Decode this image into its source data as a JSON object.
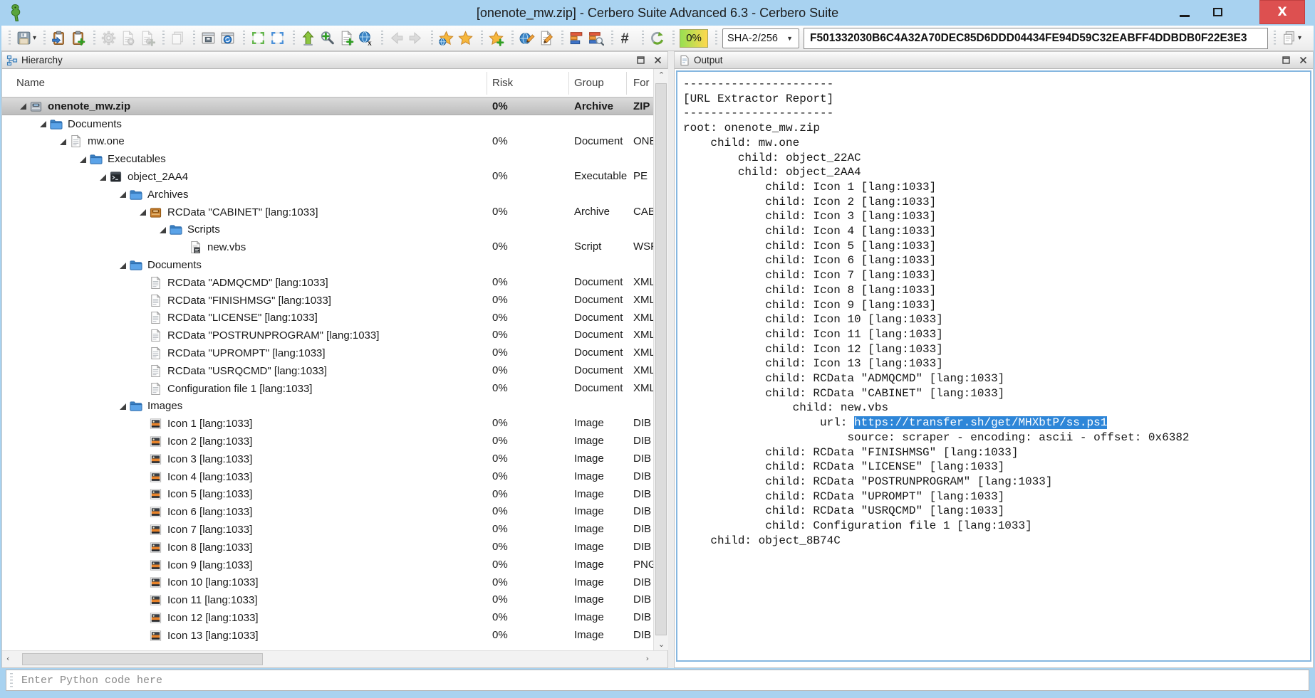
{
  "window": {
    "title": "[onenote_mw.zip] - Cerbero Suite Advanced 6.3 - Cerbero Suite"
  },
  "toolbar": {
    "progress_badge": "0%",
    "hash_algorithm": "SHA-2/256",
    "hash_value": "F501332030B6C4A32A70DEC85D6DDD04434FE94D59C32EABFF4DDBDB0F22E3E3",
    "button_groups": [
      [
        {
          "name": "save",
          "icon": "floppy",
          "caret": true
        }
      ],
      [
        {
          "name": "paste-analyze",
          "icon": "clipboard-arrow"
        },
        {
          "name": "paste-add",
          "icon": "clipboard-plus"
        }
      ],
      [
        {
          "name": "settings",
          "icon": "gear",
          "disabled": true
        },
        {
          "name": "file-settings",
          "icon": "page-gear",
          "disabled": true
        },
        {
          "name": "file-add-settings",
          "icon": "page-plus-gear",
          "disabled": true
        }
      ],
      [
        {
          "name": "copy",
          "icon": "copy-pages",
          "disabled": true
        }
      ],
      [
        {
          "name": "save-layout",
          "icon": "window-save"
        },
        {
          "name": "sync-view",
          "icon": "window-sync"
        }
      ],
      [
        {
          "name": "select-region-green",
          "icon": "select-corners-green"
        },
        {
          "name": "select-region-blue",
          "icon": "select-corners-blue"
        }
      ],
      [
        {
          "name": "insert-tool",
          "icon": "plug-up"
        },
        {
          "name": "zoom-add",
          "icon": "magnifier-plus"
        },
        {
          "name": "page-add",
          "icon": "page-plus"
        },
        {
          "name": "hex-globe",
          "icon": "globe-x"
        }
      ],
      [
        {
          "name": "back",
          "icon": "arrow-left",
          "disabled": true
        },
        {
          "name": "forward",
          "icon": "arrow-right",
          "disabled": true
        }
      ],
      [
        {
          "name": "bookmark-global",
          "icon": "star-globe"
        },
        {
          "name": "bookmark",
          "icon": "star"
        }
      ],
      [
        {
          "name": "bookmark-add",
          "icon": "star-plus"
        }
      ],
      [
        {
          "name": "edit-global",
          "icon": "globe-pencil"
        },
        {
          "name": "notes",
          "icon": "page-pencil"
        }
      ],
      [
        {
          "name": "statistics",
          "icon": "bars"
        },
        {
          "name": "statistics-inspect",
          "icon": "bars-magnifier"
        }
      ],
      [
        {
          "name": "hash-symbol",
          "icon": "hash"
        }
      ],
      [
        {
          "name": "recompute-hash",
          "icon": "refresh"
        }
      ]
    ],
    "copy_hash_button": {
      "name": "copy-hash",
      "icon": "copy-export",
      "caret": true
    }
  },
  "hierarchy": {
    "title": "Hierarchy",
    "columns": [
      "Name",
      "Risk",
      "Group",
      "For"
    ],
    "rows": [
      {
        "name": "onenote_mw.zip",
        "icon": "zip-archive",
        "level": 0,
        "expander": true,
        "risk": "0%",
        "group": "Archive",
        "format": "ZIP",
        "selected": true
      },
      {
        "name": "Documents",
        "icon": "folder",
        "level": 1,
        "expander": true,
        "risk": "",
        "group": "",
        "format": ""
      },
      {
        "name": "mw.one",
        "icon": "document",
        "level": 2,
        "expander": true,
        "risk": "0%",
        "group": "Document",
        "format": "ONE"
      },
      {
        "name": "Executables",
        "icon": "folder",
        "level": 3,
        "expander": true,
        "risk": "",
        "group": "",
        "format": ""
      },
      {
        "name": "object_2AA4",
        "icon": "executable",
        "level": 4,
        "expander": true,
        "risk": "0%",
        "group": "Executable",
        "format": "PE"
      },
      {
        "name": "Archives",
        "icon": "folder",
        "level": 5,
        "expander": true,
        "risk": "",
        "group": "",
        "format": ""
      },
      {
        "name": "RCData \"CABINET\" [lang:1033]",
        "icon": "cab-archive",
        "level": 6,
        "expander": true,
        "risk": "0%",
        "group": "Archive",
        "format": "CAB"
      },
      {
        "name": "Scripts",
        "icon": "folder",
        "level": 7,
        "expander": true,
        "risk": "",
        "group": "",
        "format": ""
      },
      {
        "name": "new.vbs",
        "icon": "script",
        "level": 8,
        "expander": false,
        "risk": "0%",
        "group": "Script",
        "format": "WSF"
      },
      {
        "name": "Documents",
        "icon": "folder",
        "level": 5,
        "expander": true,
        "risk": "",
        "group": "",
        "format": ""
      },
      {
        "name": "RCData \"ADMQCMD\" [lang:1033]",
        "icon": "document",
        "level": 6,
        "expander": false,
        "risk": "0%",
        "group": "Document",
        "format": "XML"
      },
      {
        "name": "RCData \"FINISHMSG\" [lang:1033]",
        "icon": "document",
        "level": 6,
        "expander": false,
        "risk": "0%",
        "group": "Document",
        "format": "XML"
      },
      {
        "name": "RCData \"LICENSE\" [lang:1033]",
        "icon": "document",
        "level": 6,
        "expander": false,
        "risk": "0%",
        "group": "Document",
        "format": "XML"
      },
      {
        "name": "RCData \"POSTRUNPROGRAM\" [lang:1033]",
        "icon": "document",
        "level": 6,
        "expander": false,
        "risk": "0%",
        "group": "Document",
        "format": "XML"
      },
      {
        "name": "RCData \"UPROMPT\" [lang:1033]",
        "icon": "document",
        "level": 6,
        "expander": false,
        "risk": "0%",
        "group": "Document",
        "format": "XML"
      },
      {
        "name": "RCData \"USRQCMD\" [lang:1033]",
        "icon": "document",
        "level": 6,
        "expander": false,
        "risk": "0%",
        "group": "Document",
        "format": "XML"
      },
      {
        "name": "Configuration file 1 [lang:1033]",
        "icon": "document",
        "level": 6,
        "expander": false,
        "risk": "0%",
        "group": "Document",
        "format": "XML"
      },
      {
        "name": "Images",
        "icon": "folder",
        "level": 5,
        "expander": true,
        "risk": "",
        "group": "",
        "format": ""
      },
      {
        "name": "Icon 1 [lang:1033]",
        "icon": "image",
        "level": 6,
        "expander": false,
        "risk": "0%",
        "group": "Image",
        "format": "DIB"
      },
      {
        "name": "Icon 2 [lang:1033]",
        "icon": "image",
        "level": 6,
        "expander": false,
        "risk": "0%",
        "group": "Image",
        "format": "DIB"
      },
      {
        "name": "Icon 3 [lang:1033]",
        "icon": "image",
        "level": 6,
        "expander": false,
        "risk": "0%",
        "group": "Image",
        "format": "DIB"
      },
      {
        "name": "Icon 4 [lang:1033]",
        "icon": "image",
        "level": 6,
        "expander": false,
        "risk": "0%",
        "group": "Image",
        "format": "DIB"
      },
      {
        "name": "Icon 5 [lang:1033]",
        "icon": "image",
        "level": 6,
        "expander": false,
        "risk": "0%",
        "group": "Image",
        "format": "DIB"
      },
      {
        "name": "Icon 6 [lang:1033]",
        "icon": "image",
        "level": 6,
        "expander": false,
        "risk": "0%",
        "group": "Image",
        "format": "DIB"
      },
      {
        "name": "Icon 7 [lang:1033]",
        "icon": "image",
        "level": 6,
        "expander": false,
        "risk": "0%",
        "group": "Image",
        "format": "DIB"
      },
      {
        "name": "Icon 8 [lang:1033]",
        "icon": "image",
        "level": 6,
        "expander": false,
        "risk": "0%",
        "group": "Image",
        "format": "DIB"
      },
      {
        "name": "Icon 9 [lang:1033]",
        "icon": "image",
        "level": 6,
        "expander": false,
        "risk": "0%",
        "group": "Image",
        "format": "PNG"
      },
      {
        "name": "Icon 10 [lang:1033]",
        "icon": "image",
        "level": 6,
        "expander": false,
        "risk": "0%",
        "group": "Image",
        "format": "DIB"
      },
      {
        "name": "Icon 11 [lang:1033]",
        "icon": "image",
        "level": 6,
        "expander": false,
        "risk": "0%",
        "group": "Image",
        "format": "DIB"
      },
      {
        "name": "Icon 12 [lang:1033]",
        "icon": "image",
        "level": 6,
        "expander": false,
        "risk": "0%",
        "group": "Image",
        "format": "DIB"
      },
      {
        "name": "Icon 13 [lang:1033]",
        "icon": "image",
        "level": 6,
        "expander": false,
        "risk": "0%",
        "group": "Image",
        "format": "DIB"
      }
    ]
  },
  "output": {
    "title": "Output",
    "lines": [
      "----------------------",
      "[URL Extractor Report]",
      "----------------------",
      "root: onenote_mw.zip",
      "    child: mw.one",
      "        child: object_22AC",
      "        child: object_2AA4",
      "            child: Icon 1 [lang:1033]",
      "            child: Icon 2 [lang:1033]",
      "            child: Icon 3 [lang:1033]",
      "            child: Icon 4 [lang:1033]",
      "            child: Icon 5 [lang:1033]",
      "            child: Icon 6 [lang:1033]",
      "            child: Icon 7 [lang:1033]",
      "            child: Icon 8 [lang:1033]",
      "            child: Icon 9 [lang:1033]",
      "            child: Icon 10 [lang:1033]",
      "            child: Icon 11 [lang:1033]",
      "            child: Icon 12 [lang:1033]",
      "            child: Icon 13 [lang:1033]",
      "            child: RCData \"ADMQCMD\" [lang:1033]",
      "            child: RCData \"CABINET\" [lang:1033]",
      "                child: new.vbs",
      {
        "prefix": "                    url: ",
        "highlight": "https://transfer.sh/get/MHXbtP/ss.ps1"
      },
      "                        source: scraper - encoding: ascii - offset: 0x6382",
      "            child: RCData \"FINISHMSG\" [lang:1033]",
      "            child: RCData \"LICENSE\" [lang:1033]",
      "            child: RCData \"POSTRUNPROGRAM\" [lang:1033]",
      "            child: RCData \"UPROMPT\" [lang:1033]",
      "            child: RCData \"USRQCMD\" [lang:1033]",
      "            child: Configuration file 1 [lang:1033]",
      "    child: object_8B74C"
    ]
  },
  "console": {
    "placeholder": "Enter Python code here"
  },
  "colors": {
    "titlebar": "#a8d2f0",
    "close_button": "#dd5050",
    "selection_highlight": "#2e86d8",
    "progress_gradient": [
      "#97e052",
      "#ffd84d"
    ],
    "folder_blue": "#4a94dc",
    "selected_row": "#c9c9c9"
  }
}
